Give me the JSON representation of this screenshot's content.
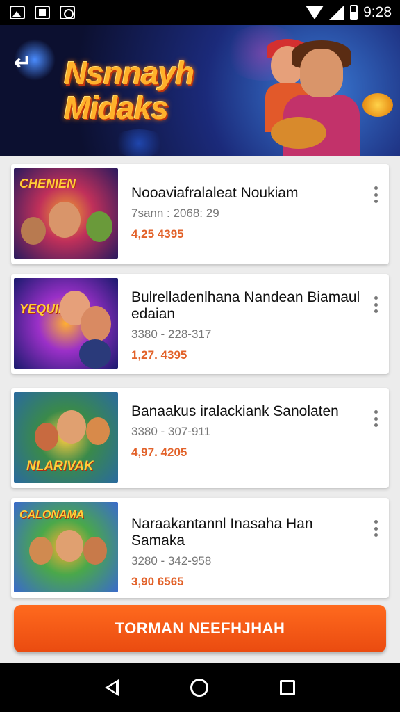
{
  "status_bar": {
    "time": "9:28"
  },
  "banner": {
    "title_line1": "Nsnnayh",
    "title_line2": "Midaks"
  },
  "games": [
    {
      "title": "Nooaviafralaleat Noukiam",
      "meta": "7sann : 2068: 29",
      "price": "4,25 4395",
      "thumb_text": "CHENIEN",
      "thumb_colors": [
        "#2a1a5e",
        "#c0305a",
        "#f0a030"
      ]
    },
    {
      "title": "Bulrelladenlhana Nandean Biamaul edaian",
      "meta": "3380 - 228-317",
      "price": "1,27. 4395",
      "thumb_text": "YEQUIN",
      "thumb_colors": [
        "#1a1a6e",
        "#9b30c8",
        "#ffb030"
      ]
    },
    {
      "title": "Banaakus iralackiank Sanolaten",
      "meta": "3380 - 307-911",
      "price": "4,97. 4205",
      "thumb_text": "NLARIVAK",
      "thumb_colors": [
        "#2a6a9e",
        "#3a8a4a",
        "#ffcc40"
      ]
    },
    {
      "title": "Naraakantannl Inasaha Han Samaka",
      "meta": "3280 - 342-958",
      "price": "3,90 6565",
      "thumb_text": "CALONAMA",
      "thumb_colors": [
        "#3a6acc",
        "#4aa84a",
        "#ffb030"
      ]
    }
  ],
  "cta": {
    "label": "TORMAN NEEFHJHAH"
  },
  "icons": {
    "status_left": [
      "photo-icon",
      "book-icon",
      "gear-icon"
    ],
    "status_right": [
      "wifi-icon",
      "signal-icon",
      "battery-icon"
    ]
  }
}
